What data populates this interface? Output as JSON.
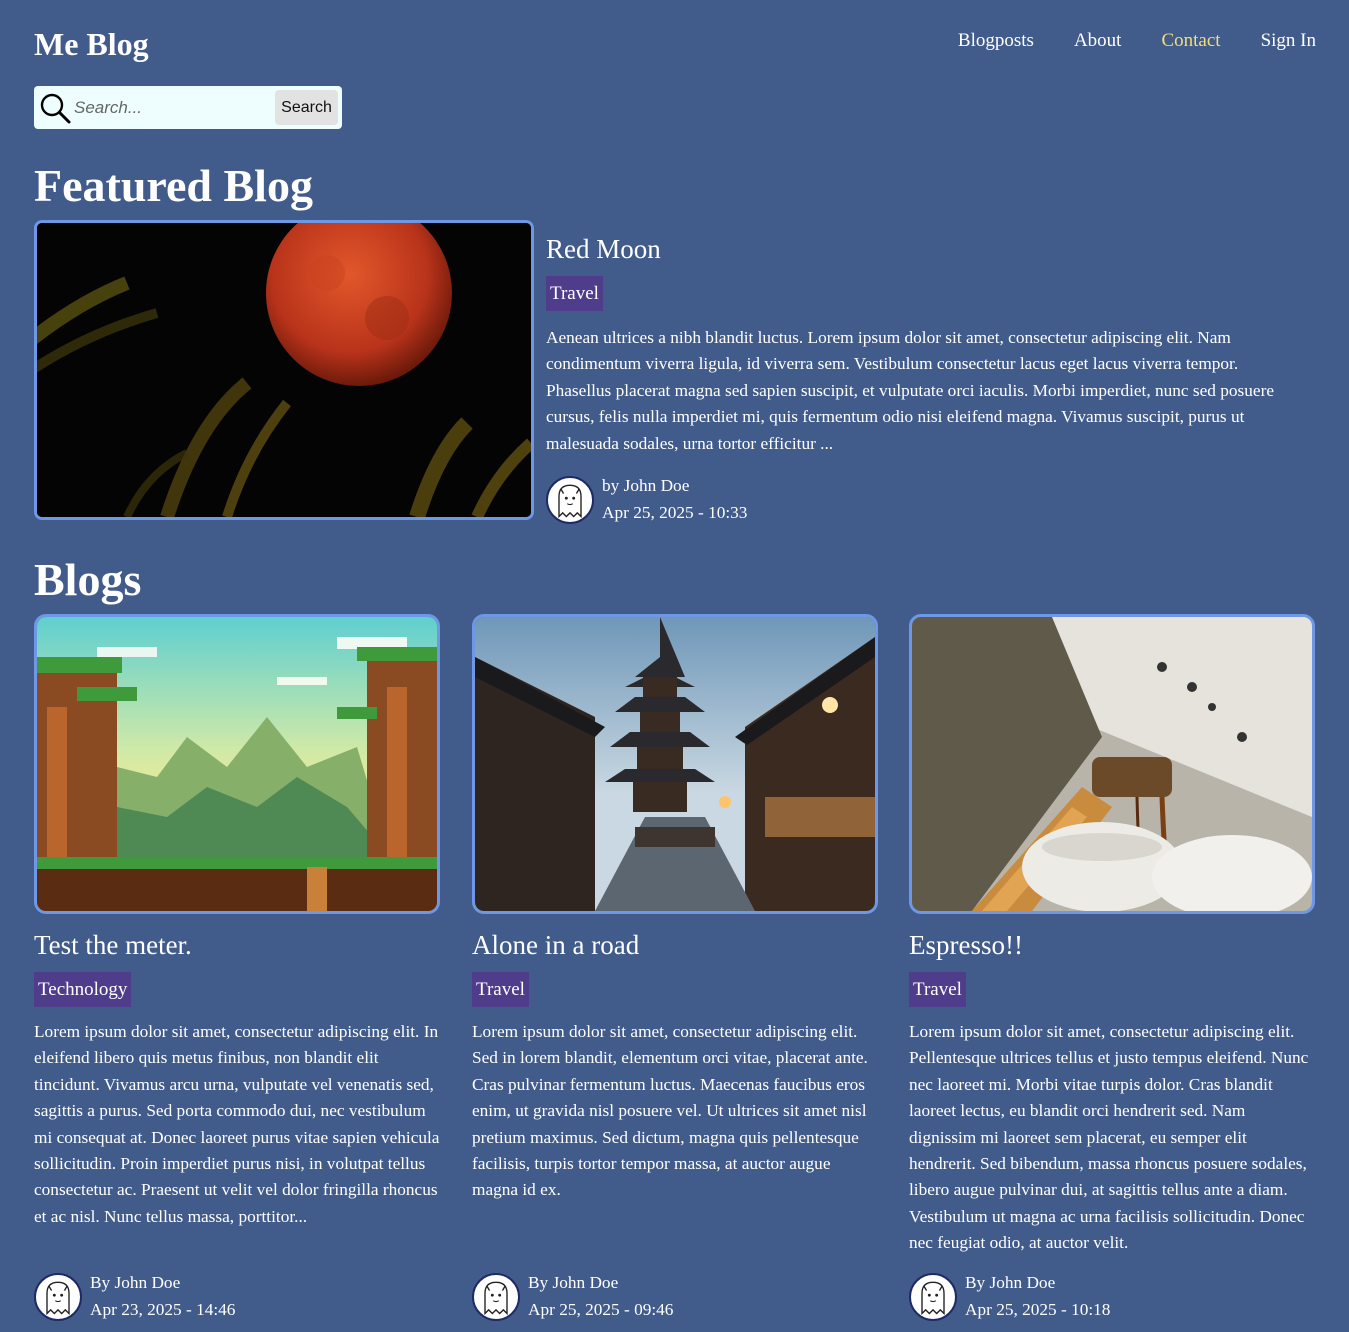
{
  "header": {
    "logo": "Me Blog",
    "nav": [
      {
        "label": "Blogposts",
        "active": false
      },
      {
        "label": "About",
        "active": false
      },
      {
        "label": "Contact",
        "active": true
      },
      {
        "label": "Sign In",
        "active": false
      }
    ]
  },
  "search": {
    "placeholder": "Search...",
    "button_label": "Search"
  },
  "featured": {
    "section_title": "Featured Blog",
    "title": "Red Moon",
    "tag": "Travel",
    "excerpt": "Aenean ultrices a nibh blandit luctus. Lorem ipsum dolor sit amet, consectetur adipiscing elit. Nam condimentum viverra ligula, id viverra sem. Vestibulum consectetur lacus eget lacus viverra tempor. Phasellus placerat magna sed sapien suscipit, et vulputate orci iaculis. Morbi imperdiet, nunc sed posuere cursus, felis nulla imperdiet mi, quis fermentum odio nisi eleifend magna. Vivamus suscipit, purus ut malesuada sodales, urna tortor efficitur ...",
    "author": "by John Doe",
    "date": "Apr 25, 2025 - 10:33"
  },
  "blogs": {
    "section_title": "Blogs",
    "posts": [
      {
        "title": "Test the meter.",
        "tag": "Technology",
        "excerpt": "Lorem ipsum dolor sit amet, consectetur adipiscing elit. In eleifend libero quis metus finibus, non blandit elit tincidunt. Vivamus arcu urna, vulputate vel venenatis sed, sagittis a purus. Sed porta commodo dui, nec vestibulum mi consequat at. Donec laoreet purus vitae sapien vehicula sollicitudin. Proin imperdiet purus nisi, in volutpat tellus consectetur ac. Praesent ut velit vel dolor fringilla rhoncus et ac nisl. Nunc tellus massa, porttitor...",
        "author": "By John Doe",
        "date": "Apr 23, 2025 - 14:46"
      },
      {
        "title": "Alone in a road",
        "tag": "Travel",
        "excerpt": "Lorem ipsum dolor sit amet, consectetur adipiscing elit. Sed in lorem blandit, elementum orci vitae, placerat ante. Cras pulvinar fermentum luctus. Maecenas faucibus eros enim, ut gravida nisl posuere vel. Ut ultrices sit amet nisl pretium maximus. Sed dictum, magna quis pellentesque facilisis, turpis tortor tempor massa, at auctor augue magna id ex.",
        "author": "By John Doe",
        "date": "Apr 25, 2025 - 09:46"
      },
      {
        "title": "Espresso!!",
        "tag": "Travel",
        "excerpt": "Lorem ipsum dolor sit amet, consectetur adipiscing elit. Pellentesque ultrices tellus et justo tempus eleifend. Nunc nec laoreet mi. Morbi vitae turpis dolor. Cras blandit laoreet lectus, eu blandit orci hendrerit sed. Nam dignissim mi laoreet sem placerat, eu semper elit hendrerit. Sed bibendum, massa rhoncus posuere sodales, libero augue pulvinar dui, at sagittis tellus ante a diam. Vestibulum ut magna ac urna facilisis sollicitudin. Donec nec feugiat odio, at auctor velit.",
        "author": "By John Doe",
        "date": "Apr 25, 2025 - 10:18"
      }
    ]
  },
  "colors": {
    "background": "#415b8a",
    "tag": "#4f3c8b",
    "image_border": "#6e97e6",
    "nav_active": "#f3de7a"
  }
}
